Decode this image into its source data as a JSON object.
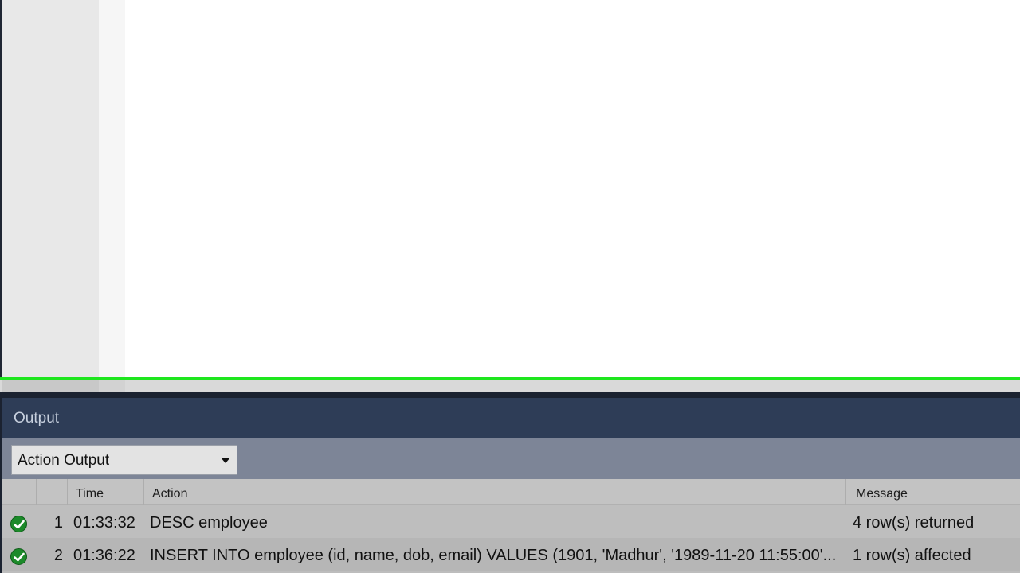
{
  "output_panel": {
    "title": "Output",
    "action_selector": {
      "selected": "Action Output"
    },
    "columns": {
      "time": "Time",
      "action": "Action",
      "message": "Message"
    },
    "rows": [
      {
        "number": "1",
        "time": "01:33:32",
        "action": "DESC employee",
        "message": "4 row(s) returned",
        "status_icon": "success-check-icon"
      },
      {
        "number": "2",
        "time": "01:36:22",
        "action": "INSERT INTO employee (id, name, dob, email) VALUES (1901, 'Madhur', '1989-11-20 11:55:00'...",
        "message": "1 row(s) affected",
        "status_icon": "success-check-icon"
      }
    ]
  },
  "colors": {
    "highlight": "#1ee61e",
    "header_bg": "#2e3d57",
    "toolbar_bg": "#7d8597",
    "success": "#1c8a2a"
  }
}
